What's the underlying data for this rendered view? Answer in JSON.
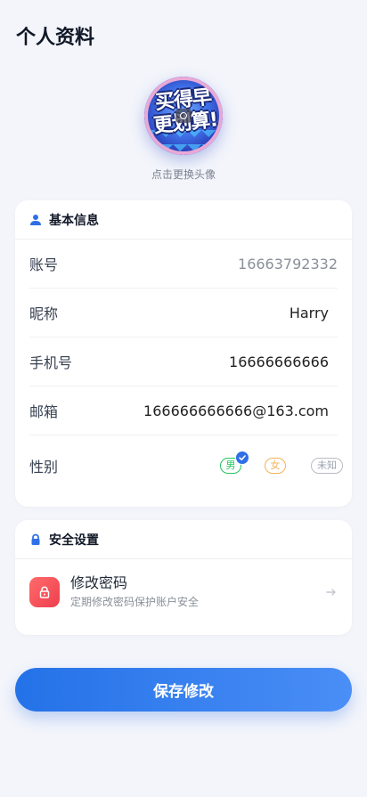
{
  "page": {
    "title": "个人资料"
  },
  "avatar": {
    "image_text": "买得早 更划算!",
    "hint": "点击更换头像"
  },
  "basic_info": {
    "title": "基本信息",
    "account": {
      "label": "账号",
      "value": "16663792332"
    },
    "nickname": {
      "label": "昵称",
      "value": "Harry"
    },
    "phone": {
      "label": "手机号",
      "value": "16666666666"
    },
    "email": {
      "label": "邮箱",
      "value": "166666666666@163.com"
    },
    "gender": {
      "label": "性别",
      "options": [
        "男",
        "女",
        "未知"
      ],
      "selected": "男"
    }
  },
  "security": {
    "title": "安全设置",
    "change_password": {
      "title": "修改密码",
      "subtitle": "定期修改密码保护账户安全"
    }
  },
  "save_button": {
    "label": "保存修改"
  },
  "colors": {
    "primary": "#2f6fe8",
    "male": "#22c55e",
    "female": "#f2b35b",
    "unknown": "#b8bcc4",
    "danger": "#ee3f4e"
  }
}
